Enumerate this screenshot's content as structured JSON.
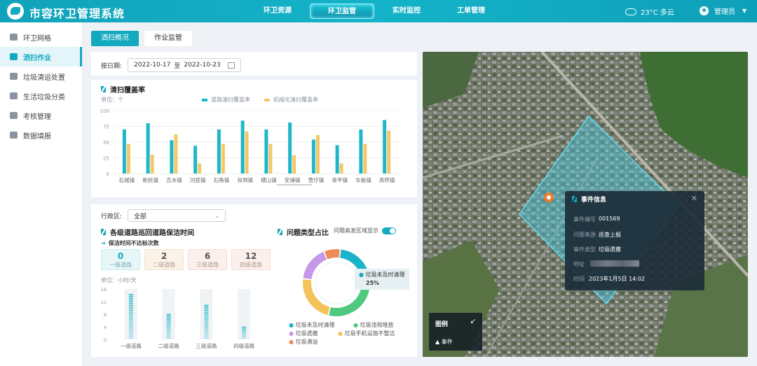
{
  "header": {
    "title": "市容环卫管理系统",
    "nav": [
      "环卫资源",
      "环卫监管",
      "实时监控",
      "工单管理"
    ],
    "active_nav": 1,
    "weather": "23°C  多云",
    "user": "管理员"
  },
  "sidebar": {
    "items": [
      "环卫网格",
      "洒扫作业",
      "垃圾清运处置",
      "生活垃圾分类",
      "考核管理",
      "数据填报"
    ],
    "active": 1
  },
  "tabs": {
    "items": [
      "洒扫概况",
      "作业监管"
    ],
    "active": 0
  },
  "filter": {
    "date_label": "按日期:",
    "date_start": "2022-10-17",
    "date_sep": "至",
    "date_end": "2022-10-23"
  },
  "coverage": {
    "title": "清扫覆盖率",
    "unit": "单位：个",
    "legend": [
      "道路清扫覆盖率",
      "机械化清扫覆盖率"
    ]
  },
  "region": {
    "label": "行政区:",
    "value": "全部"
  },
  "patrol": {
    "title": "各级道路巡回道路保洁时间",
    "subtitle": "保洁时间不达标次数",
    "unit": "单位：小时/天",
    "cards": [
      {
        "num": "0",
        "label": "一级道路"
      },
      {
        "num": "2",
        "label": "二级道路"
      },
      {
        "num": "6",
        "label": "三级道路"
      },
      {
        "num": "12",
        "label": "四级道路"
      }
    ]
  },
  "problem": {
    "title": "问题类型占比",
    "toggle_label": "问题高发区域显示",
    "tooltip_label": "垃圾未及时清理",
    "tooltip_value": "25%",
    "legend": [
      "垃圾未及时清理",
      "垃圾违规堆放",
      "垃圾遗撒",
      "垃圾手机设施不整洁",
      "垃圾满溢"
    ]
  },
  "event": {
    "title": "事件信息",
    "rows": [
      {
        "k": "事件编号",
        "v": "001569"
      },
      {
        "k": "问题来源",
        "v": "巡查上报"
      },
      {
        "k": "事件类型",
        "v": "垃圾遗撒"
      },
      {
        "k": "地址",
        "v": ""
      },
      {
        "k": "时间",
        "v": "2023年1月5日   14:02"
      }
    ]
  },
  "map_legend": {
    "title": "图例",
    "item": "事件"
  },
  "colors": {
    "accent": "#13a9bf",
    "bar1": "#1fb6c8",
    "bar2": "#f3c76a",
    "donut": [
      "#1bb3c9",
      "#4fc97f",
      "#f3c35a",
      "#c797e8",
      "#f08a57"
    ]
  },
  "chart_data": [
    {
      "type": "bar",
      "title": "清扫覆盖率",
      "ylim": [
        0,
        100
      ],
      "yticks": [
        0,
        25,
        50,
        75,
        100
      ],
      "categories": [
        "石城镇",
        "新民镇",
        "吉水镇",
        "河底镇",
        "石角镇",
        "良垌镇",
        "横山镇",
        "安铺镇",
        "营仔镇",
        "青平镇",
        "车板镇",
        "高桥镇"
      ],
      "series": [
        {
          "name": "道路清扫覆盖率",
          "values": [
            70,
            80,
            53,
            44,
            70,
            84,
            70,
            81,
            54,
            45,
            70,
            85
          ]
        },
        {
          "name": "机械化清扫覆盖率",
          "values": [
            47,
            30,
            62,
            16,
            47,
            67,
            47,
            29,
            61,
            16,
            47,
            68
          ]
        }
      ]
    },
    {
      "type": "bar",
      "title": "各级道路巡回道路保洁时间",
      "ylim": [
        0,
        16
      ],
      "yticks": [
        0,
        4,
        8,
        12,
        16
      ],
      "categories": [
        "一级道路",
        "二级道路",
        "三级道路",
        "四级道路"
      ],
      "values": [
        14.5,
        8,
        11,
        4
      ]
    },
    {
      "type": "pie",
      "title": "问题类型占比",
      "categories": [
        "垃圾未及时清理",
        "垃圾违规堆放",
        "垃圾遗撒",
        "垃圾手机设施不整洁",
        "垃圾满溢"
      ],
      "values": [
        25,
        27,
        23,
        17,
        8
      ]
    }
  ]
}
